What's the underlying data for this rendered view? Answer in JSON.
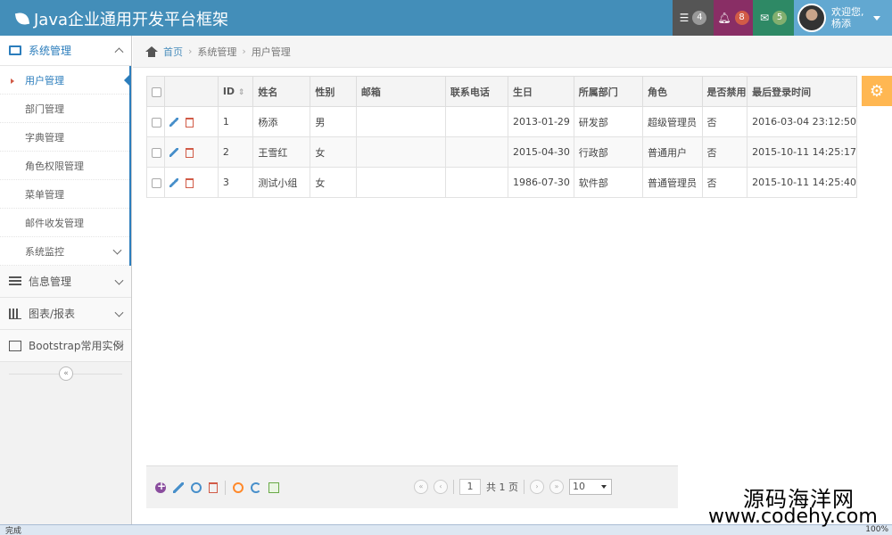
{
  "app": {
    "title": "Java企业通用开发平台框架"
  },
  "navbar": {
    "tasks_count": "4",
    "notifications_count": "8",
    "messages_count": "5",
    "welcome": "欢迎您,",
    "user_name": "杨添",
    "colors": {
      "bar": "#438eb9",
      "tasks": "#555555",
      "notifications": "#892e65",
      "messages": "#2e8965",
      "user": "#62a8d1"
    }
  },
  "sidebar": {
    "groups": [
      {
        "label": "系统管理",
        "icon": "monitor-icon",
        "expanded": true,
        "items": [
          {
            "label": "用户管理",
            "active": true
          },
          {
            "label": "部门管理"
          },
          {
            "label": "字典管理"
          },
          {
            "label": "角色权限管理"
          },
          {
            "label": "菜单管理"
          },
          {
            "label": "邮件收发管理"
          },
          {
            "label": "系统监控"
          }
        ]
      },
      {
        "label": "信息管理",
        "icon": "list-icon"
      },
      {
        "label": "图表/报表",
        "icon": "bar-chart-icon"
      },
      {
        "label": "Bootstrap常用实例",
        "icon": "edit-icon"
      }
    ],
    "collapse_symbol": "«"
  },
  "breadcrumb": {
    "home": "首页",
    "section": "系统管理",
    "current": "用户管理"
  },
  "table": {
    "columns": [
      "ID",
      "姓名",
      "性别",
      "邮箱",
      "联系电话",
      "生日",
      "所属部门",
      "角色",
      "是否禁用",
      "最后登录时间"
    ],
    "rows": [
      {
        "id": "1",
        "name": "杨添",
        "gender": "男",
        "email": "",
        "phone": "",
        "birthday": "2013-01-29",
        "dept": "研发部",
        "role": "超级管理员",
        "disabled": "否",
        "last_login": "2016-03-04 23:12:50"
      },
      {
        "id": "2",
        "name": "王雪红",
        "gender": "女",
        "email": "",
        "phone": "",
        "birthday": "2015-04-30",
        "dept": "行政部",
        "role": "普通用户",
        "disabled": "否",
        "last_login": "2015-10-11 14:25:17"
      },
      {
        "id": "3",
        "name": "测试小组",
        "gender": "女",
        "email": "",
        "phone": "",
        "birthday": "1986-07-30",
        "dept": "软件部",
        "role": "普通管理员",
        "disabled": "否",
        "last_login": "2015-10-11 14:25:40"
      }
    ]
  },
  "pager": {
    "page_input": "1",
    "total_pages_text": "共 1 页",
    "page_size": "10",
    "first_symbol": "«",
    "prev_symbol": "‹",
    "next_symbol": "›",
    "last_symbol": "»"
  },
  "statusbar": {
    "text": "完成",
    "zoom": "100%"
  },
  "watermark": {
    "cn": "源码海洋网",
    "url": "www.codehy.com"
  }
}
